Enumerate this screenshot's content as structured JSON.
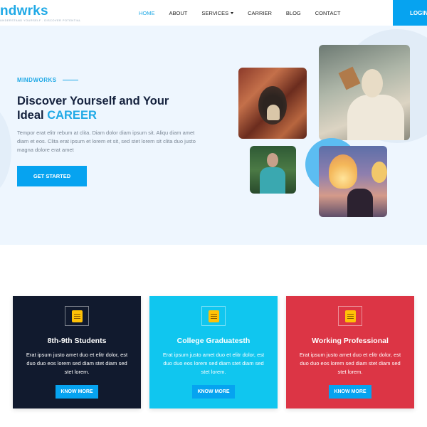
{
  "brand": {
    "logo_text": "ndwrks",
    "tagline": "UNDERSTAND YOURSELF . DISCOVER POTENTIAL"
  },
  "nav": {
    "items": [
      {
        "label": "HOME",
        "active": true
      },
      {
        "label": "ABOUT",
        "active": false
      },
      {
        "label": "SERVICES",
        "active": false
      },
      {
        "label": "CARRIER",
        "active": false
      },
      {
        "label": "BLOG",
        "active": false
      },
      {
        "label": "CONTACT",
        "active": false
      }
    ],
    "login_label": "LOGIN"
  },
  "hero": {
    "eyebrow": "MINDWORKS",
    "title_line1": "Discover Yourself and Your",
    "title_line2_prefix": "Ideal ",
    "title_line2_accent": "CAREER",
    "description": "Tempor erat elitr rebum at clita. Diam dolor diam ipsum sit. Aliqu diam amet diam et eos. Clita erat ipsum et lorem et sit, sed stet lorem sit clita duo justo magna dolore erat amet",
    "cta_label": "GET STARTED"
  },
  "cards": [
    {
      "title": "8th-9th Students",
      "description": "Erat ipsum justo amet duo et elitr dolor, est duo duo eos lorem sed diam stet diam sed stet lorem.",
      "button_label": "KNOW MORE",
      "icon": "book-icon",
      "color": "#111a2e"
    },
    {
      "title": "College Graduatesth",
      "description": "Erat ipsum justo amet duo et elitr dolor, est duo duo eos lorem sed diam stet diam sed stet lorem.",
      "button_label": "KNOW MORE",
      "icon": "book-icon",
      "color": "#10c6ef"
    },
    {
      "title": "Working Professional",
      "description": "Erat ipsum justo amet duo et elitr dolor, est duo duo eos lorem sed diam stet diam sed stet lorem.",
      "button_label": "KNOW MORE",
      "icon": "book-icon",
      "color": "#dc3545"
    }
  ],
  "colors": {
    "accent": "#1fa9e6",
    "button": "#06a3f0",
    "dark": "#14213d",
    "hero_bg": "#eef6fe"
  }
}
